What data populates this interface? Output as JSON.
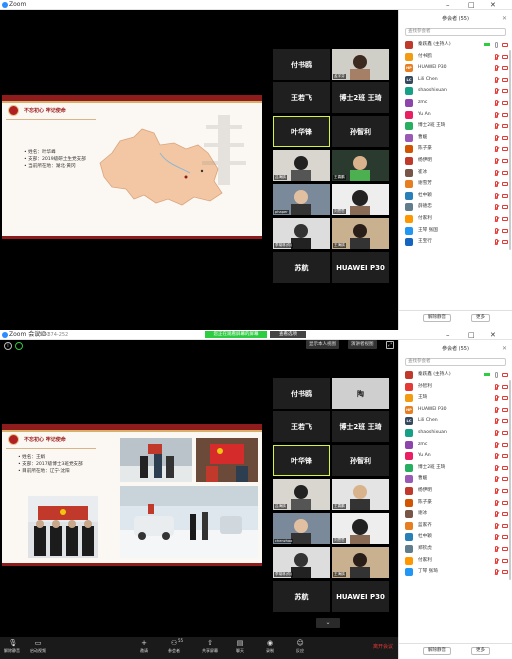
{
  "window1": {
    "title": "Zoom",
    "panel_title": "参会者 (55)",
    "search_placeholder": "查找参会者",
    "slide": {
      "slogan": "不忘初心 牢记使命",
      "info": [
        "姓名：叶华峰",
        "支部：2019级研土生党支部",
        "当前所在地：湖北·黄冈"
      ]
    },
    "tiles": [
      {
        "name": "付书鸥",
        "tag": ""
      },
      {
        "name": "",
        "tag": "孟宇芬"
      },
      {
        "name": "王若飞",
        "tag": ""
      },
      {
        "name": "博士2班 王琦",
        "tag": ""
      },
      {
        "name": "叶华锋",
        "tag": ""
      },
      {
        "name": "孙智利",
        "tag": ""
      },
      {
        "name": "",
        "tag": "吕海鸥"
      },
      {
        "name": "",
        "tag": "王喜鹏"
      },
      {
        "name": "",
        "tag": "phaper"
      },
      {
        "name": "",
        "tag": "刘思思"
      },
      {
        "name": "",
        "tag": "李胡林(你)"
      },
      {
        "name": "",
        "tag": "王海鸥"
      },
      {
        "name": "苏航",
        "tag": ""
      },
      {
        "name": "HUAWEI P30",
        "tag": ""
      }
    ],
    "participants": [
      {
        "initials": "",
        "name": "秦跃鑫 (主持人)",
        "color": "#c0392b",
        "mic": "on",
        "cam": "off",
        "host": true
      },
      {
        "initials": "",
        "name": "付书鸥",
        "color": "#f39c12",
        "mic": "muted",
        "cam": "off"
      },
      {
        "initials": "HP",
        "name": "HUAWEI P30",
        "color": "#e67e22",
        "mic": "muted",
        "cam": "off"
      },
      {
        "initials": "LC",
        "name": "Lili Chen",
        "color": "#34495e",
        "mic": "muted",
        "cam": "off"
      },
      {
        "initials": "",
        "name": "shaoshixuan",
        "color": "#16a085",
        "mic": "muted",
        "cam": "off"
      },
      {
        "initials": "",
        "name": "zmc",
        "color": "#8e44ad",
        "mic": "muted",
        "cam": "off"
      },
      {
        "initials": "",
        "name": "Yu An",
        "color": "#e91e63",
        "mic": "muted",
        "cam": "off"
      },
      {
        "initials": "",
        "name": "博士2班 王琦",
        "color": "#27ae60",
        "mic": "muted",
        "cam": "off"
      },
      {
        "initials": "",
        "name": "曹媛",
        "color": "#9b59b6",
        "mic": "muted",
        "cam": "off"
      },
      {
        "initials": "",
        "name": "陈子豪",
        "color": "#d35400",
        "mic": "muted",
        "cam": "off"
      },
      {
        "initials": "",
        "name": "杨伊明",
        "color": "#c0392b",
        "mic": "muted",
        "cam": "off"
      },
      {
        "initials": "",
        "name": "崔冰",
        "color": "#795548",
        "mic": "muted",
        "cam": "off"
      },
      {
        "initials": "",
        "name": "谢雪芳",
        "color": "#e67e22",
        "mic": "muted",
        "cam": "off"
      },
      {
        "initials": "",
        "name": "杜中颖",
        "color": "#2980b9",
        "mic": "muted",
        "cam": "off"
      },
      {
        "initials": "",
        "name": "薛德忠",
        "color": "#607d8b",
        "mic": "muted",
        "cam": "off"
      },
      {
        "initials": "",
        "name": "付家利",
        "color": "#ff9800",
        "mic": "muted",
        "cam": "off"
      },
      {
        "initials": "",
        "name": "王琴 张国",
        "color": "#2196f3",
        "mic": "muted",
        "cam": "off"
      },
      {
        "initials": "",
        "name": "王宝行",
        "color": "#1565c0",
        "mic": "muted",
        "cam": "off"
      }
    ],
    "mute_all": "解除静音",
    "more": "更多"
  },
  "window2": {
    "title": "Zoom 会议ID：",
    "meeting_id": "657-874-252",
    "banner": "您正在观看屏幕的屏幕",
    "banner2": "查看选项",
    "view_btn1": "显示本人视图",
    "view_btn2": "演讲者视图",
    "panel_title": "参会者 (55)",
    "search_placeholder": "查找参会者",
    "slide": {
      "slogan": "不忘初心 牢记使命",
      "info": [
        "姓名：王娟",
        "支部：2017级博士3班党支部",
        "目前所在地：辽宁·沈阳"
      ]
    },
    "tiles": [
      {
        "name": "付书鸥",
        "tag": ""
      },
      {
        "name": "陶",
        "tag": ""
      },
      {
        "name": "王若飞",
        "tag": ""
      },
      {
        "name": "博士2班 王琦",
        "tag": ""
      },
      {
        "name": "叶华锋",
        "tag": ""
      },
      {
        "name": "孙智利",
        "tag": ""
      },
      {
        "name": "",
        "tag": "吕海鸥"
      },
      {
        "name": "",
        "tag": "王喜鹏"
      },
      {
        "name": "",
        "tag": "chenzhao"
      },
      {
        "name": "",
        "tag": "刘思思"
      },
      {
        "name": "",
        "tag": "李胡林(你)"
      },
      {
        "name": "",
        "tag": "王海鸥"
      },
      {
        "name": "苏航",
        "tag": ""
      },
      {
        "name": "HUAWEI P30",
        "tag": ""
      }
    ],
    "participants": [
      {
        "initials": "",
        "name": "秦跃鑫 (主持人)",
        "color": "#c0392b",
        "mic": "on",
        "cam": "off",
        "host": true
      },
      {
        "initials": "",
        "name": "孙智利",
        "color": "#e53935",
        "mic": "muted",
        "cam": "off"
      },
      {
        "initials": "",
        "name": "王琦",
        "color": "#f39c12",
        "mic": "muted",
        "cam": "off"
      },
      {
        "initials": "HP",
        "name": "HUAWEI P30",
        "color": "#e67e22",
        "mic": "muted",
        "cam": "off"
      },
      {
        "initials": "LC",
        "name": "Lili Chen",
        "color": "#34495e",
        "mic": "muted",
        "cam": "off"
      },
      {
        "initials": "",
        "name": "shaoshixuan",
        "color": "#16a085",
        "mic": "muted",
        "cam": "off"
      },
      {
        "initials": "",
        "name": "zmc",
        "color": "#8e44ad",
        "mic": "muted",
        "cam": "off"
      },
      {
        "initials": "",
        "name": "Yu An",
        "color": "#e91e63",
        "mic": "muted",
        "cam": "off"
      },
      {
        "initials": "",
        "name": "博士2班 王琦",
        "color": "#27ae60",
        "mic": "muted",
        "cam": "off"
      },
      {
        "initials": "",
        "name": "曹媛",
        "color": "#9b59b6",
        "mic": "muted",
        "cam": "off"
      },
      {
        "initials": "",
        "name": "杨伊明",
        "color": "#c0392b",
        "mic": "muted",
        "cam": "off"
      },
      {
        "initials": "",
        "name": "陈子豪",
        "color": "#d35400",
        "mic": "muted",
        "cam": "off"
      },
      {
        "initials": "",
        "name": "谢冰",
        "color": "#795548",
        "mic": "muted",
        "cam": "off"
      },
      {
        "initials": "",
        "name": "蓝家齐",
        "color": "#e67e22",
        "mic": "muted",
        "cam": "off"
      },
      {
        "initials": "",
        "name": "杜中颖",
        "color": "#2980b9",
        "mic": "muted",
        "cam": "off"
      },
      {
        "initials": "",
        "name": "郑钦虎",
        "color": "#607d8b",
        "mic": "muted",
        "cam": "off"
      },
      {
        "initials": "",
        "name": "付家利",
        "color": "#ff9800",
        "mic": "muted",
        "cam": "off"
      },
      {
        "initials": "",
        "name": "丁琴 张琦",
        "color": "#2196f3",
        "mic": "muted",
        "cam": "off"
      }
    ],
    "mute_all": "解除静音",
    "more": "更多",
    "toolbar": [
      {
        "label": "解除静音",
        "icon": "microphone-muted-icon",
        "glyph": "🎙"
      },
      {
        "label": "启动视频",
        "icon": "video-off-icon",
        "glyph": "▭"
      },
      {
        "label": "邀请",
        "icon": "invite-icon",
        "glyph": "+"
      },
      {
        "label": "参会者",
        "icon": "participants-icon",
        "glyph": "⚇"
      },
      {
        "label": "共享屏幕",
        "icon": "share-screen-icon",
        "glyph": "⇧"
      },
      {
        "label": "聊天",
        "icon": "chat-icon",
        "glyph": "▤"
      },
      {
        "label": "录制",
        "icon": "record-icon",
        "glyph": "◉"
      },
      {
        "label": "反应",
        "icon": "reactions-icon",
        "glyph": "☺"
      }
    ],
    "participant_count": "55",
    "end_label": "离开会议"
  },
  "colors": {
    "accent": "#2d8cff",
    "slide_red": "#9b1b1b",
    "active_tile": "#d5f53a",
    "muted": "#e53935"
  }
}
